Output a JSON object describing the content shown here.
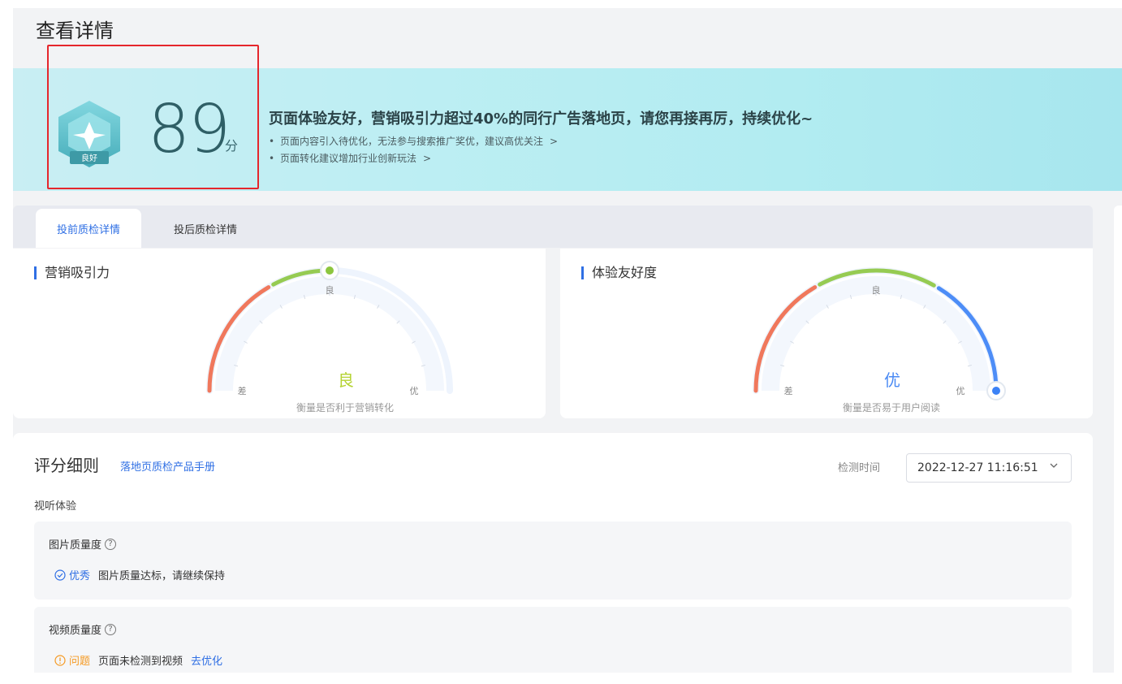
{
  "header": {
    "back_icon": "chevron-left-icon",
    "title": "查看详情"
  },
  "banner": {
    "badge_label": "良好",
    "score": "89",
    "score_unit": "分",
    "headline": "页面体验友好，营销吸引力超过40%的同行广告落地页，请您再接再厉，持续优化~",
    "tips": [
      {
        "text": "页面内容引入待优化，无法参与搜索推广奖优，建议高优关注",
        "arrow": ">"
      },
      {
        "text": "页面转化建议增加行业创新玩法",
        "arrow": ">"
      }
    ]
  },
  "tabs": [
    {
      "label": "投前质检详情",
      "active": true
    },
    {
      "label": "投后质检详情",
      "active": false
    }
  ],
  "gauges": [
    {
      "title": "营销吸引力",
      "level": "良",
      "level_color": "#b5d334",
      "low_label": "差",
      "mid_label": "良",
      "high_label": "优",
      "caption": "衡量是否利于营销转化",
      "pointer": 0.5
    },
    {
      "title": "体验友好度",
      "level": "优",
      "level_color": "#4a8af4",
      "low_label": "差",
      "mid_label": "良",
      "high_label": "优",
      "caption": "衡量是否易于用户阅读",
      "pointer": 1.0
    }
  ],
  "rules": {
    "title": "评分细则",
    "manual_link": "落地页质检产品手册",
    "detect_label": "检测时间",
    "detect_time": "2022-12-27 11:16:51",
    "section": "视听体验",
    "items": [
      {
        "title": "图片质量度",
        "status_label": "优秀",
        "status_icon": "check-circle-icon",
        "desc": "图片质量达标，请继续保持",
        "link": ""
      },
      {
        "title": "视频质量度",
        "status_label": "问题",
        "status_icon": "warning-circle-icon",
        "desc": "页面未检测到视频",
        "link": "去优化"
      }
    ]
  },
  "colors": {
    "accent": "#2f6fe4",
    "warn": "#f59a23",
    "highlight": "#e5262c",
    "gauge_red": "#f06a4a",
    "gauge_green": "#8cc63f",
    "gauge_blue": "#3b82f6"
  }
}
